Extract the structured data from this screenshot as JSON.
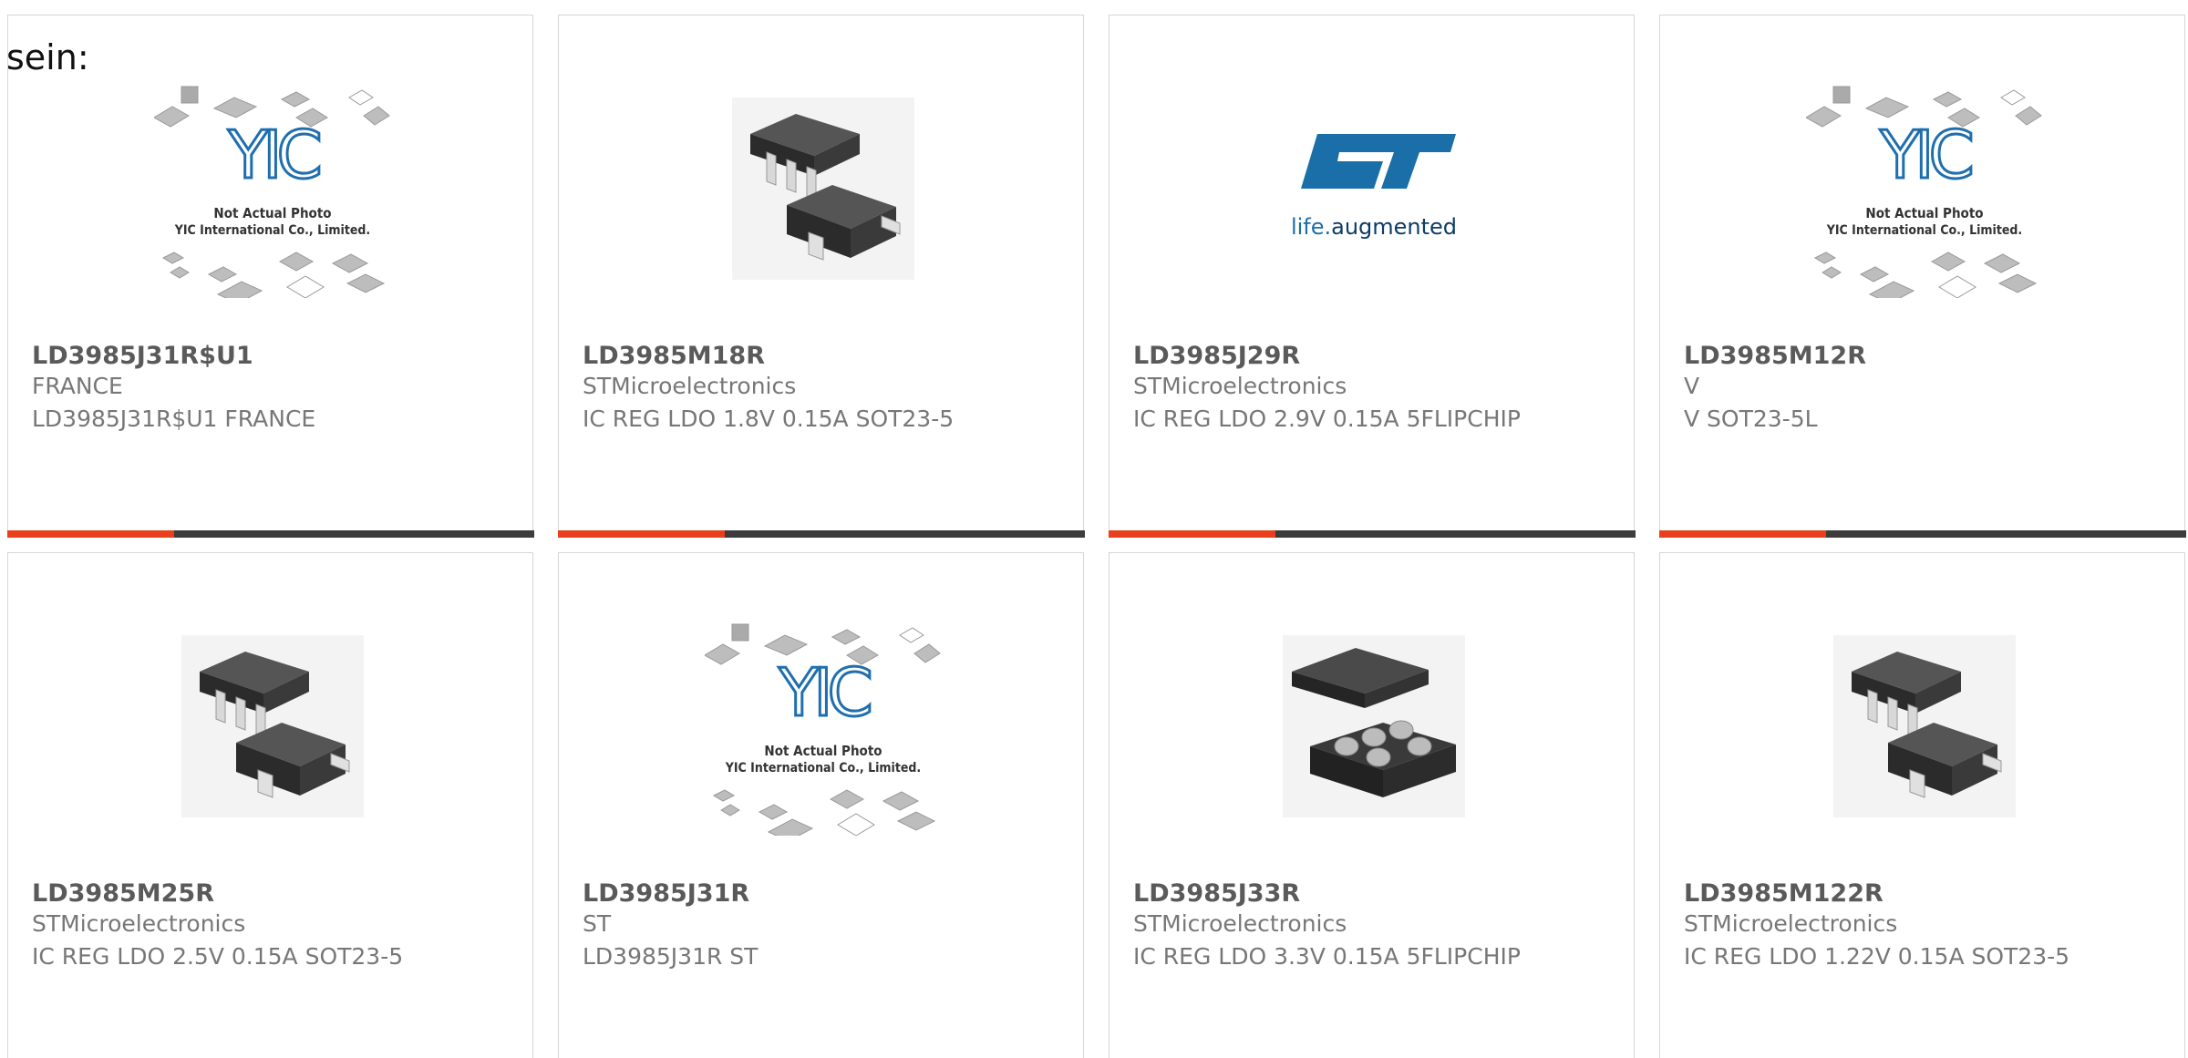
{
  "intro_text": "sein:",
  "products": [
    {
      "part": "LD3985J31R$U1",
      "maker": "FRANCE",
      "desc": "LD3985J31R$U1 FRANCE",
      "image": "yic-placeholder"
    },
    {
      "part": "LD3985M18R",
      "maker": "STMicroelectronics",
      "desc": "IC REG LDO 1.8V 0.15A SOT23-5",
      "image": "sot23-5-package"
    },
    {
      "part": "LD3985J29R",
      "maker": "STMicroelectronics",
      "desc": "IC REG LDO 2.9V 0.15A 5FLIPCHIP",
      "image": "st-logo"
    },
    {
      "part": "LD3985M12R",
      "maker": "V",
      "desc": "V SOT23-5L",
      "image": "yic-placeholder"
    },
    {
      "part": "LD3985M25R",
      "maker": "STMicroelectronics",
      "desc": "IC REG LDO 2.5V 0.15A SOT23-5",
      "image": "sot23-5-package"
    },
    {
      "part": "LD3985J31R",
      "maker": "ST",
      "desc": "LD3985J31R ST",
      "image": "yic-placeholder"
    },
    {
      "part": "LD3985J33R",
      "maker": "STMicroelectronics",
      "desc": "IC REG LDO 3.3V 0.15A 5FLIPCHIP",
      "image": "flipchip-package"
    },
    {
      "part": "LD3985M122R",
      "maker": "STMicroelectronics",
      "desc": "IC REG LDO 1.22V 0.15A SOT23-5",
      "image": "sot23-5-package"
    }
  ],
  "placeholder": {
    "line1": "Not Actual Photo",
    "line2": "YIC International Co., Limited."
  },
  "st_logo": {
    "tagline_a": "life.",
    "tagline_b": "augmented"
  },
  "colors": {
    "accent": "#e8401c",
    "bar": "#3c3c3c",
    "st_blue": "#1a6fa8"
  }
}
